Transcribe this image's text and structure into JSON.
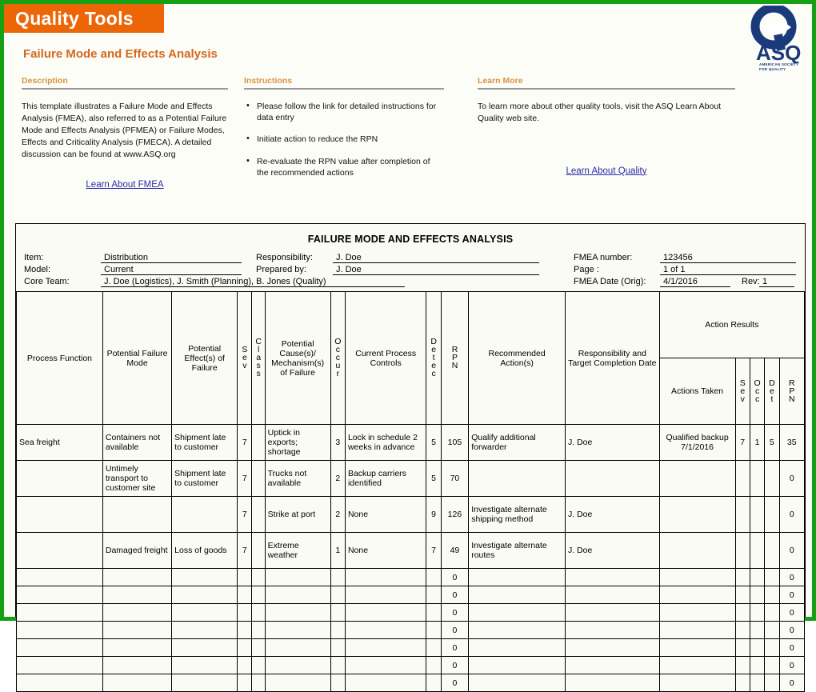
{
  "banner": {
    "title": "Quality Tools"
  },
  "logo": {
    "wordmark": "ASQ",
    "tagline_line1": "AMERICAN SOCIETY",
    "tagline_line2": "FOR QUALITY"
  },
  "subtitle": "Failure Mode and Effects Analysis",
  "colors": {
    "banner_orange": "#ec6608",
    "subtitle_orange": "#d2691e",
    "section_heading": "#d8943f",
    "frame_green": "#16a014",
    "link_blue": "#2a2aa8",
    "logo_blue": "#1b3a7a"
  },
  "description": {
    "heading": "Description",
    "body": "This template illustrates a Failure Mode and Effects Analysis (FMEA), also referred to as a Potential Failure Mode and Effects Analysis (PFMEA) or Failure Modes, Effects and Criticality Analysis (FMECA).  A detailed discussion can be found at www.ASQ.org",
    "link": "Learn About FMEA"
  },
  "instructions": {
    "heading": "Instructions",
    "bullets": [
      "Please follow the link for detailed instructions for data entry",
      "Initiate action to reduce the RPN",
      "Re-evaluate the RPN value after completion of the recommended actions"
    ]
  },
  "learn_more": {
    "heading": "Learn More",
    "body": "To learn more about other quality tools, visit the ASQ Learn About Quality web site.",
    "link": "Learn About Quality"
  },
  "sheet": {
    "title": "FAILURE MODE AND EFFECTS ANALYSIS",
    "fields": {
      "item_label": "Item:",
      "item_value": "Distribution",
      "model_label": "Model:",
      "model_value": "Current",
      "core_team_label": "Core Team:",
      "core_team_value": "J. Doe (Logistics), J. Smith (Planning), B. Jones (Quality)",
      "responsibility_label": "Responsibility:",
      "responsibility_value": "J. Doe",
      "prepared_by_label": "Prepared by:",
      "prepared_by_value": "J. Doe",
      "fmea_number_label": "FMEA number:",
      "fmea_number_value": "123456",
      "page_label": "Page :",
      "page_value": "1 of 1",
      "fmea_date_label": "FMEA Date (Orig):",
      "fmea_date_value": "4/1/2016",
      "rev_label": "Rev:",
      "rev_value": "1"
    },
    "action_results_header": "Action Results",
    "columns": [
      "Process Function",
      "Potential Failure Mode",
      "Potential Effect(s) of Failure",
      "Sev",
      "Class",
      "Potential Cause(s)/ Mechanism(s) of Failure",
      "Occur",
      "Current Process Controls",
      "Detec",
      "RPN",
      "Recommended Action(s)",
      "Responsibility and Target Completion Date",
      "Actions Taken",
      "Sev",
      "Occ",
      "Det",
      "RPN"
    ],
    "rows": [
      {
        "process_function": "Sea freight",
        "failure_mode": "Containers not available",
        "effect": "Shipment late to customer",
        "sev": "7",
        "class": "",
        "cause": "Uptick in exports; shortage",
        "occ": "3",
        "controls": "Lock in schedule 2 weeks in advance",
        "det": "5",
        "rpn": "105",
        "recommended": "Qualify additional forwarder",
        "responsibility": "J. Doe",
        "actions_taken": "Qualified backup 7/1/2016",
        "a_sev": "7",
        "a_occ": "1",
        "a_det": "5",
        "a_rpn": "35"
      },
      {
        "process_function": "",
        "failure_mode": "Untimely transport to customer site",
        "effect": "Shipment late to customer",
        "sev": "7",
        "class": "",
        "cause": "Trucks not available",
        "occ": "2",
        "controls": "Backup carriers identified",
        "det": "5",
        "rpn": "70",
        "recommended": "",
        "responsibility": "",
        "actions_taken": "",
        "a_sev": "",
        "a_occ": "",
        "a_det": "",
        "a_rpn": "0"
      },
      {
        "process_function": "",
        "failure_mode": "",
        "effect": "",
        "sev": "7",
        "class": "",
        "cause": "Strike at port",
        "occ": "2",
        "controls": "None",
        "det": "9",
        "rpn": "126",
        "recommended": "Investigate alternate shipping method",
        "responsibility": "J. Doe",
        "actions_taken": "",
        "a_sev": "",
        "a_occ": "",
        "a_det": "",
        "a_rpn": "0"
      },
      {
        "process_function": "",
        "failure_mode": "Damaged freight",
        "effect": "Loss of goods",
        "sev": "7",
        "class": "",
        "cause": "Extreme weather",
        "occ": "1",
        "controls": "None",
        "det": "7",
        "rpn": "49",
        "recommended": "Investigate alternate routes",
        "responsibility": "J. Doe",
        "actions_taken": "",
        "a_sev": "",
        "a_occ": "",
        "a_det": "",
        "a_rpn": "0"
      }
    ],
    "blank_rows": [
      {
        "rpn": "0",
        "a_rpn": "0"
      },
      {
        "rpn": "0",
        "a_rpn": "0"
      },
      {
        "rpn": "0",
        "a_rpn": "0"
      },
      {
        "rpn": "0",
        "a_rpn": "0"
      },
      {
        "rpn": "0",
        "a_rpn": "0"
      },
      {
        "rpn": "0",
        "a_rpn": "0"
      },
      {
        "rpn": "0",
        "a_rpn": "0"
      }
    ]
  }
}
